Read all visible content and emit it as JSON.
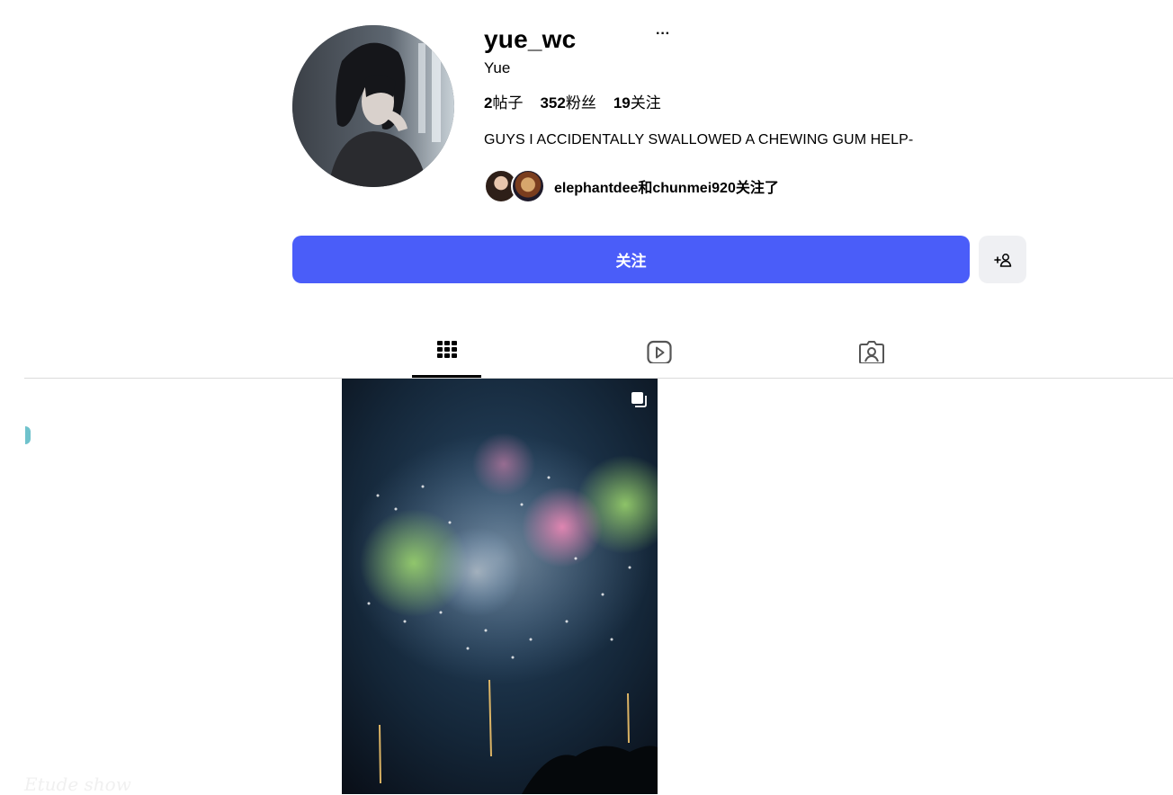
{
  "profile": {
    "username": "yue_wc",
    "full_name": "Yue",
    "more_label": "···",
    "bio": "GUYS I ACCIDENTALLY SWALLOWED A CHEWING GUM HELP-",
    "followed_by": "elephantdee和chunmei920关注了"
  },
  "stats": {
    "posts_num": "2",
    "posts_label": "帖子",
    "followers_num": "352",
    "followers_label": "粉丝",
    "following_num": "19",
    "following_label": "关注"
  },
  "actions": {
    "follow_label": "关注",
    "add_user_icon": "add-user-icon"
  },
  "tabs": [
    {
      "icon": "grid-icon",
      "active": true
    },
    {
      "icon": "reels-icon",
      "active": false
    },
    {
      "icon": "tagged-icon",
      "active": false
    }
  ],
  "posts": [
    {
      "icon": "multiple-images-icon",
      "description_icon": "fireworks"
    }
  ],
  "watermark": "Etude show",
  "colors": {
    "primary": "#4a5df9",
    "secondary_button": "#eff0f3",
    "divider": "#dbdbdb"
  }
}
